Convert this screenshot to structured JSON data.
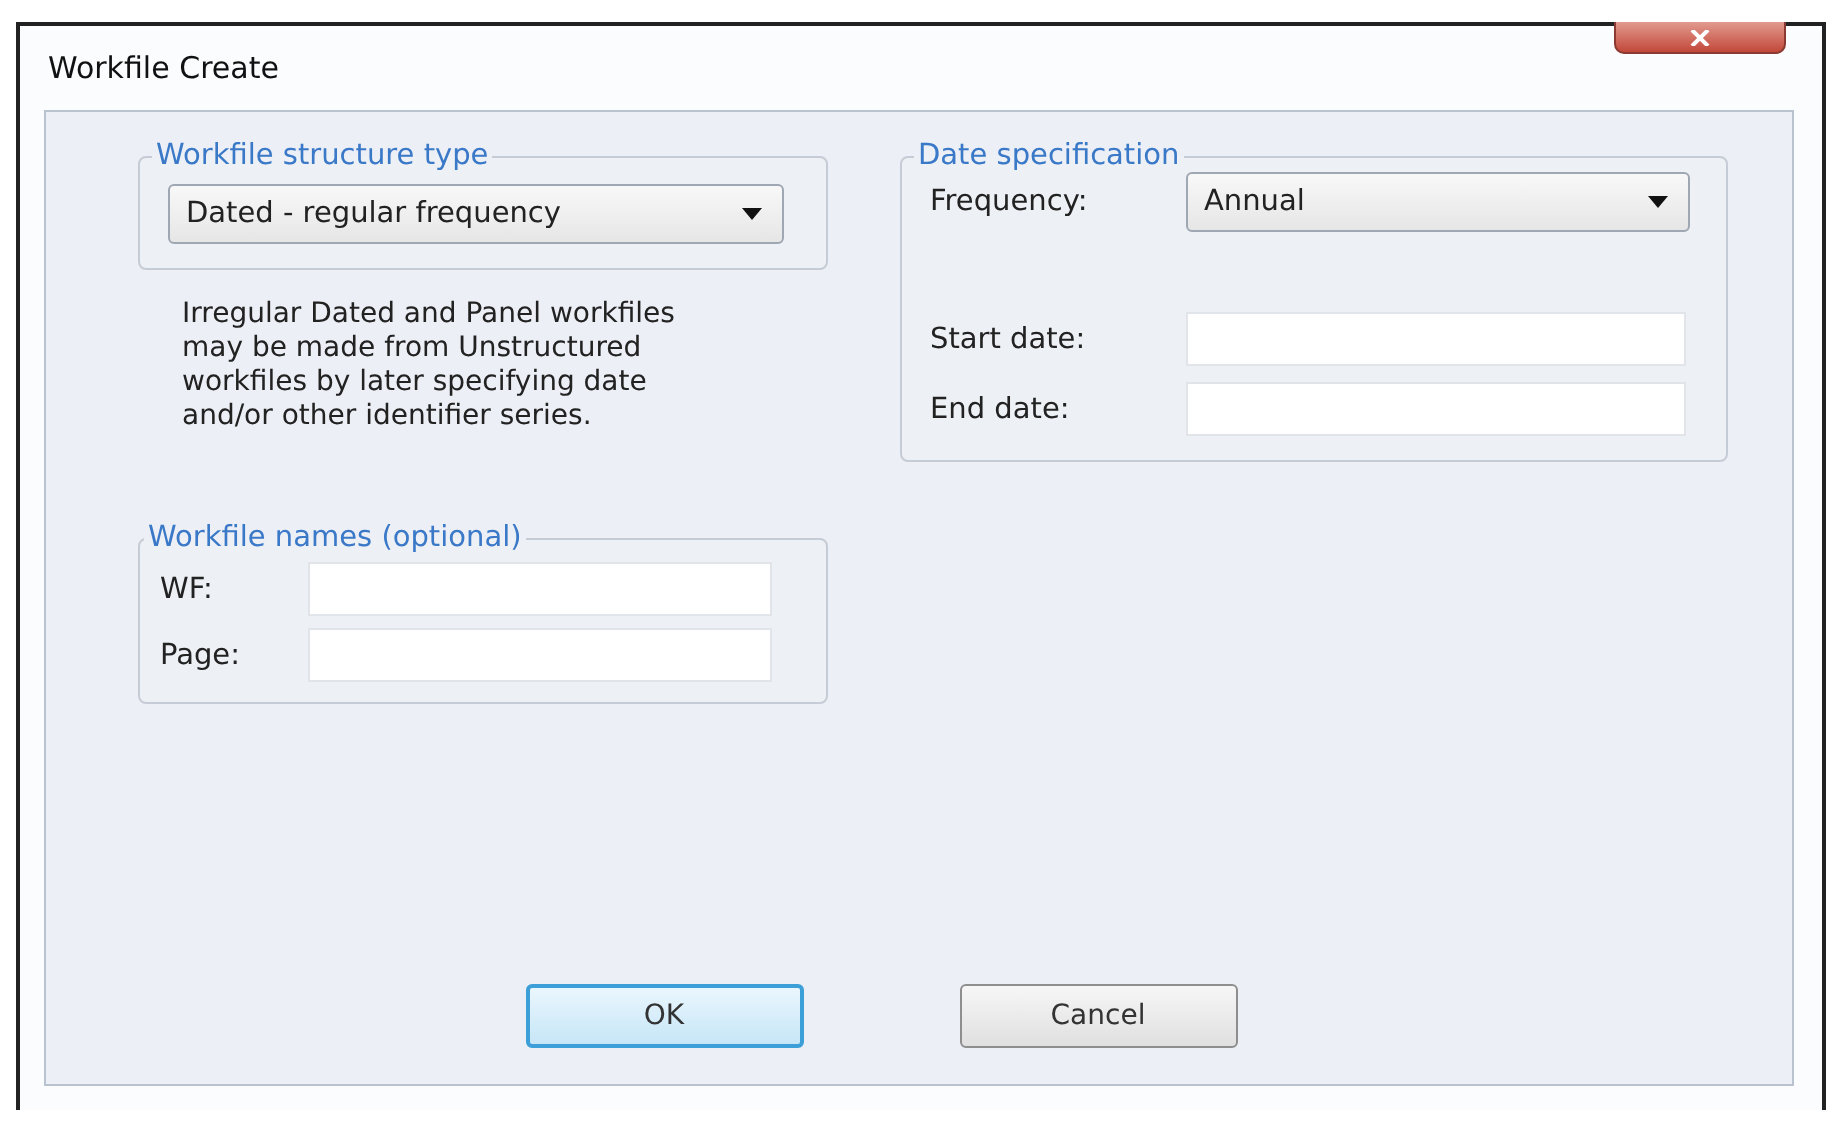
{
  "window": {
    "title": "Workfile Create"
  },
  "structure_group": {
    "legend": "Workfile structure type",
    "dropdown": {
      "value": "Dated - regular frequency"
    },
    "note": "Irregular Dated and Panel workfiles may be made from Unstructured workfiles by later specifying date and/or other identifier series."
  },
  "names_group": {
    "legend": "Workfile names (optional)",
    "fields": [
      {
        "label": "WF:"
      },
      {
        "label": "Page:"
      }
    ]
  },
  "date_group": {
    "legend": "Date specification",
    "frequency": {
      "label": "Frequency:",
      "value": "Annual"
    },
    "fields": [
      {
        "label": "Start date:"
      },
      {
        "label": "End date:"
      }
    ]
  },
  "buttons": [
    {
      "label": "OK",
      "default": true
    },
    {
      "label": "Cancel",
      "default": false
    }
  ]
}
